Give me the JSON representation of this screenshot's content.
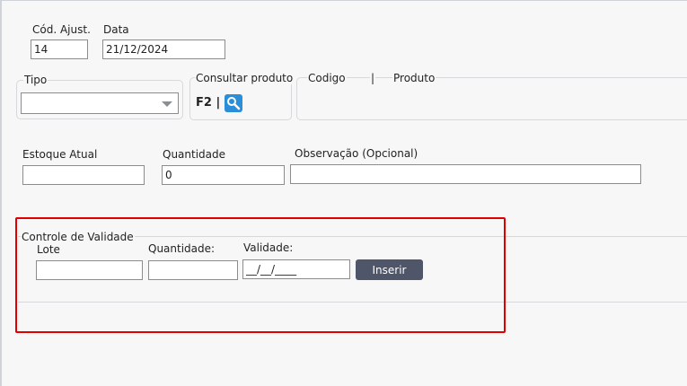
{
  "header": {
    "cod_ajust_label": "Cód. Ajust.",
    "cod_ajust_value": "14",
    "data_label": "Data",
    "data_value": "21/12/2024"
  },
  "tipo": {
    "legend": "Tipo",
    "selected": ""
  },
  "consultar": {
    "legend": "Consultar produto",
    "shortcut": "F2 |",
    "icon": "search-icon"
  },
  "produto_header": {
    "codigo_label": "Codigo",
    "separator": "|",
    "produto_label": "Produto"
  },
  "estoque": {
    "estoque_label": "Estoque Atual",
    "estoque_value": "",
    "quantidade_label": "Quantidade",
    "quantidade_value": "0",
    "observacao_label": "Observação (Opcional)",
    "observacao_value": ""
  },
  "validade": {
    "legend": "Controle de Validade",
    "lote_label": "Lote",
    "lote_value": "",
    "quantidade_label": "Quantidade:",
    "quantidade_value": "",
    "validade_label": "Validade:",
    "validade_value": "__/__/____",
    "inserir_label": "Inserir"
  },
  "colors": {
    "highlight": "#e00000",
    "button": "#4f5669",
    "search_icon": "#2a8fd6"
  }
}
